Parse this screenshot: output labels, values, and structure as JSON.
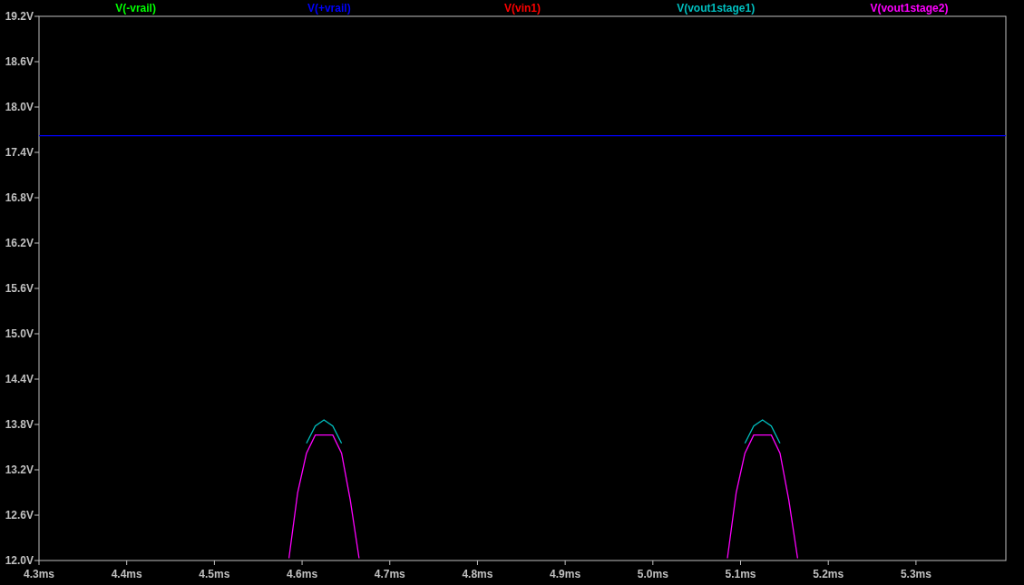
{
  "chart_data": {
    "type": "line",
    "x": [
      4.3,
      4.585,
      4.595,
      4.605,
      4.615,
      4.625,
      4.635,
      4.645,
      4.655,
      4.665,
      4.875,
      5.085,
      5.095,
      5.105,
      5.115,
      5.125,
      5.135,
      5.145,
      5.155,
      5.165,
      5.4025
    ],
    "series": [
      {
        "name": "V(-vrail)",
        "color": "#00ff00",
        "values": [
          null,
          null,
          null,
          null,
          null,
          null,
          null,
          null,
          null,
          null,
          null,
          null,
          null,
          null,
          null,
          null,
          null,
          null,
          null,
          null,
          null
        ]
      },
      {
        "name": "V(+vrail)",
        "color": "#0000ff",
        "values": [
          17.62,
          17.62,
          17.62,
          17.62,
          17.62,
          17.62,
          17.62,
          17.62,
          17.62,
          17.62,
          17.62,
          17.62,
          17.62,
          17.62,
          17.62,
          17.62,
          17.62,
          17.62,
          17.62,
          17.62,
          17.62
        ]
      },
      {
        "name": "V(vin1)",
        "color": "#ff0000",
        "values": [
          null,
          null,
          null,
          null,
          null,
          null,
          null,
          null,
          null,
          null,
          null,
          null,
          null,
          null,
          null,
          null,
          null,
          null,
          null,
          null,
          null
        ]
      },
      {
        "name": "V(vout1stage1)",
        "color": "#00bfbf",
        "values": [
          null,
          null,
          null,
          13.55,
          13.78,
          13.86,
          13.78,
          13.55,
          null,
          null,
          null,
          null,
          null,
          13.55,
          13.78,
          13.86,
          13.78,
          13.55,
          null,
          null,
          null
        ]
      },
      {
        "name": "V(vout1stage2)",
        "color": "#ff00ff",
        "values": [
          null,
          12.03,
          12.9,
          13.42,
          13.66,
          13.66,
          13.66,
          13.42,
          12.8,
          12.03,
          null,
          12.03,
          12.9,
          13.42,
          13.66,
          13.66,
          13.66,
          13.42,
          12.8,
          12.03,
          null
        ]
      }
    ],
    "xlim": [
      4.3,
      5.4025
    ],
    "ylim": [
      12.0,
      19.2
    ],
    "xticks": [
      {
        "value": 4.3,
        "label": "4.3ms"
      },
      {
        "value": 4.4,
        "label": "4.4ms"
      },
      {
        "value": 4.5,
        "label": "4.5ms"
      },
      {
        "value": 4.6,
        "label": "4.6ms"
      },
      {
        "value": 4.7,
        "label": "4.7ms"
      },
      {
        "value": 4.8,
        "label": "4.8ms"
      },
      {
        "value": 4.9,
        "label": "4.9ms"
      },
      {
        "value": 5.0,
        "label": "5.0ms"
      },
      {
        "value": 5.1,
        "label": "5.1ms"
      },
      {
        "value": 5.2,
        "label": "5.2ms"
      },
      {
        "value": 5.3,
        "label": "5.3ms"
      }
    ],
    "yticks": [
      {
        "value": 12.0,
        "label": "12.0V"
      },
      {
        "value": 12.6,
        "label": "12.6V"
      },
      {
        "value": 13.2,
        "label": "13.2V"
      },
      {
        "value": 13.8,
        "label": "13.8V"
      },
      {
        "value": 14.4,
        "label": "14.4V"
      },
      {
        "value": 15.0,
        "label": "15.0V"
      },
      {
        "value": 15.6,
        "label": "15.6V"
      },
      {
        "value": 16.2,
        "label": "16.2V"
      },
      {
        "value": 16.8,
        "label": "16.8V"
      },
      {
        "value": 17.4,
        "label": "17.4V"
      },
      {
        "value": 18.0,
        "label": "18.0V"
      },
      {
        "value": 18.6,
        "label": "18.6V"
      },
      {
        "value": 19.2,
        "label": "19.2V"
      }
    ]
  }
}
